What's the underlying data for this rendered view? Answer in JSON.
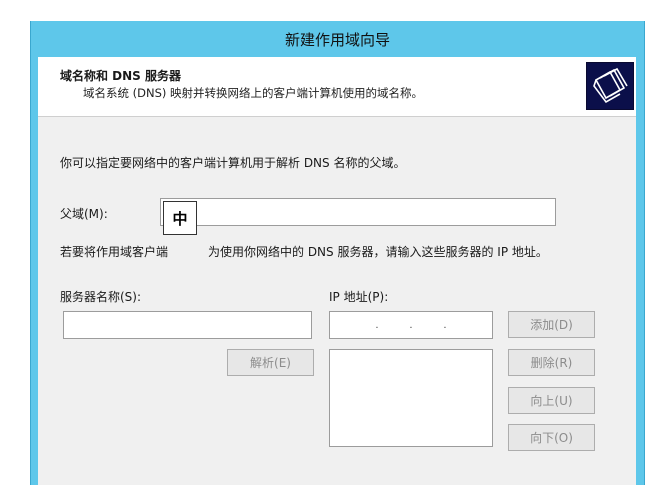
{
  "window": {
    "title": "新建作用域向导"
  },
  "header": {
    "title": "域名称和 DNS 服务器",
    "subtitle": "域名系统 (DNS) 映射并转换网络上的客户端计算机使用的域名称。",
    "icon": "folders-icon"
  },
  "body": {
    "intro": "你可以指定要网络中的客户端计算机用于解析 DNS 名称的父域。",
    "parent_domain_label": "父域(M):",
    "parent_domain_value": "",
    "dns_note_left": "若要将作用域客户端",
    "dns_note_right": "为使用你网络中的 DNS 服务器，请输入这些服务器的 IP 地址。",
    "server_name_label": "服务器名称(S):",
    "server_name_value": "",
    "ip_label": "IP 地址(P):",
    "ip_dots": [
      ".",
      ".",
      "."
    ],
    "resolve_button": "解析(E)",
    "add_button": "添加(D)",
    "remove_button": "删除(R)",
    "up_button": "向上(U)",
    "down_button": "向下(O)"
  },
  "ime": {
    "label": "中"
  },
  "colors": {
    "titlebar": "#5ec7ea",
    "client": "#f0f0f0",
    "icon_bg": "#0b0f4a"
  }
}
